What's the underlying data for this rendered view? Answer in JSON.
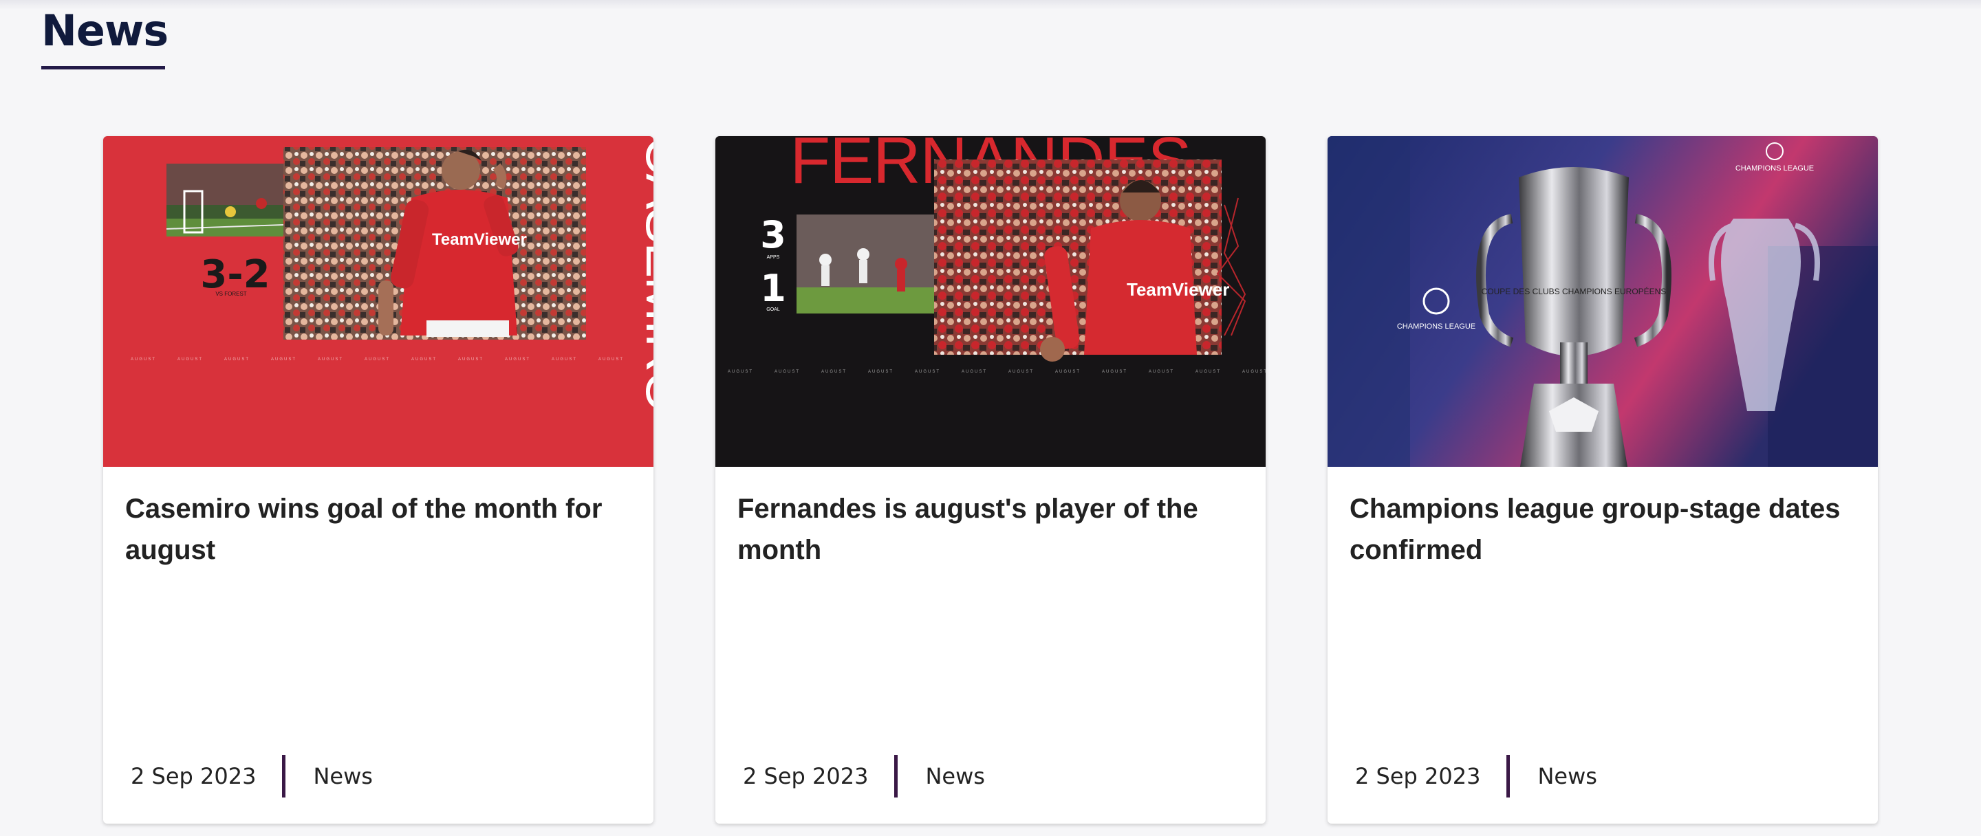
{
  "section": {
    "title": "News"
  },
  "cards": [
    {
      "title": "Casemiro wins goal of the month for august",
      "date": "2 Sep 2023",
      "category": "News",
      "image": {
        "headline": "CASEMIRO",
        "score": "3-2",
        "score_caption": "VS FOREST",
        "sponsor": "TeamViewer",
        "strip_text": "AUGUST",
        "bg_color": "#d8323b"
      }
    },
    {
      "title": "Fernandes is august's player of the month",
      "date": "2 Sep 2023",
      "category": "News",
      "image": {
        "headline": "FERNANDES",
        "stat1_value": "3",
        "stat1_label": "APPS",
        "stat2_value": "1",
        "stat2_label": "GOAL",
        "sponsor": "TeamViewer",
        "strip_text": "AUGUST",
        "bg_color": "#161416"
      }
    },
    {
      "title": "Champions league group-stage dates confirmed",
      "date": "2 Sep 2023",
      "category": "News",
      "image": {
        "logo_text": "CHAMPIONS LEAGUE",
        "trophy_text": "COUPE DES CLUBS CHAMPIONS EUROPÉENS",
        "bg_color": "#27306a"
      }
    }
  ]
}
